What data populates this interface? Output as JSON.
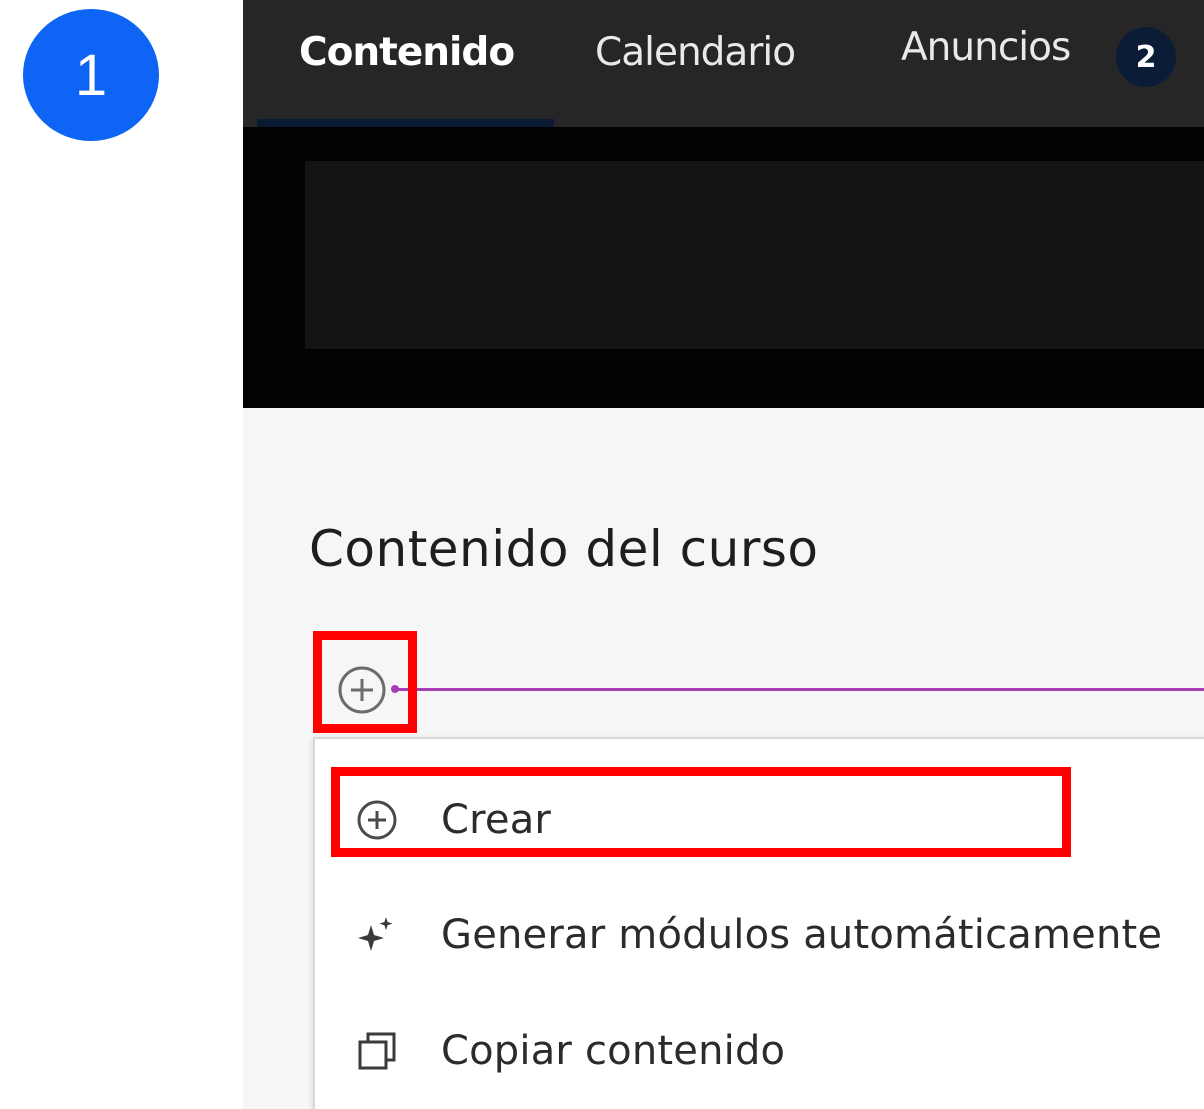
{
  "step_badge": {
    "label": "1",
    "color": "#0d64f5"
  },
  "nav": {
    "tabs": [
      {
        "label": "Contenido",
        "active": true
      },
      {
        "label": "Calendario",
        "active": false
      },
      {
        "label": "Anuncios",
        "active": false
      }
    ],
    "announcements_count": "2"
  },
  "main": {
    "section_title": "Contenido del curso",
    "add_icon": "plus-circle-icon"
  },
  "menu": {
    "items": [
      {
        "label": "Crear",
        "icon": "plus-circle-icon"
      },
      {
        "label": "Generar módulos automáticamente",
        "icon": "sparkles-icon"
      },
      {
        "label": "Copiar contenido",
        "icon": "copy-icon"
      }
    ]
  },
  "annotation": {
    "highlight_color": "#ff0000",
    "divider_color": "#a53cb3"
  }
}
